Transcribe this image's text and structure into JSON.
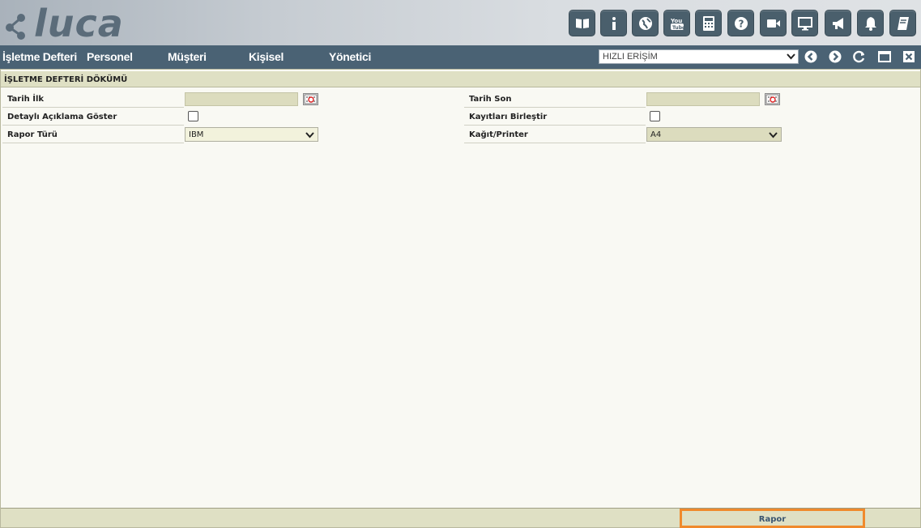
{
  "app": {
    "logo_text": "luca"
  },
  "toolbar_icons": [
    {
      "name": "book-icon"
    },
    {
      "name": "info-icon"
    },
    {
      "name": "globe-icon"
    },
    {
      "name": "youtube-icon"
    },
    {
      "name": "calculator-icon"
    },
    {
      "name": "help-icon"
    },
    {
      "name": "video-icon"
    },
    {
      "name": "monitor-icon"
    },
    {
      "name": "megaphone-icon"
    },
    {
      "name": "bell-icon"
    },
    {
      "name": "notebook-icon"
    }
  ],
  "menu": {
    "items": [
      "İşletme Defteri",
      "Personel",
      "Müşteri",
      "Kişisel",
      "Yönetici"
    ],
    "quick_access": "HIZLI ERİŞİM"
  },
  "panel": {
    "title": "İŞLETME DEFTERİ DÖKÜMÜ",
    "fields": {
      "tarih_ilk": "Tarih İlk",
      "tarih_son": "Tarih Son",
      "detayli": "Detaylı Açıklama Göster",
      "kayitlari": "Kayıtları Birleştir",
      "rapor_turu": "Rapor Türü",
      "rapor_turu_value": "IBM",
      "kagit": "Kağıt/Printer",
      "kagit_value": "A4"
    },
    "footer_button": "Rapor"
  },
  "colors": {
    "menubar": "#4a6274",
    "panel_header": "#dfe0c4",
    "highlight": "#f08a2c"
  }
}
